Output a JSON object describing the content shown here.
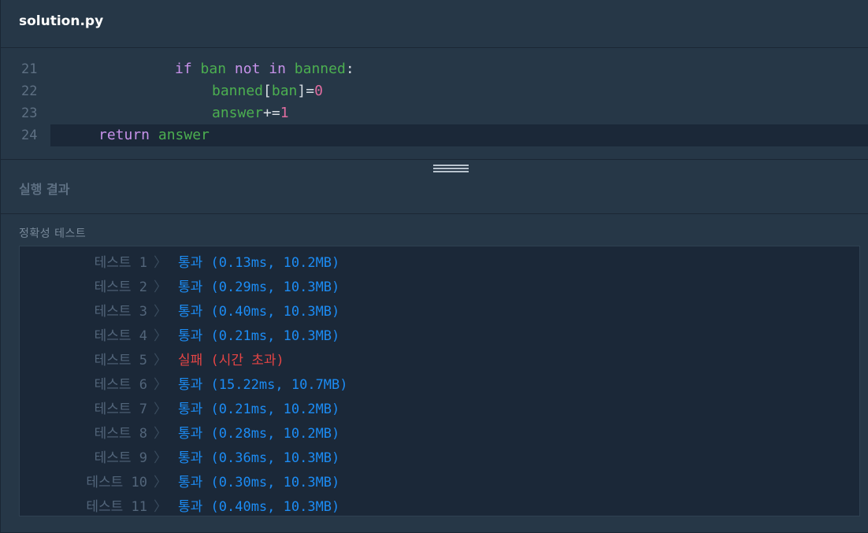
{
  "file": {
    "name": "solution.py"
  },
  "editor": {
    "lines": [
      {
        "num": "21",
        "tokens": [
          {
            "t": "if",
            "c": "kw"
          },
          {
            "t": " "
          },
          {
            "t": "ban",
            "c": "id"
          },
          {
            "t": " "
          },
          {
            "t": "not",
            "c": "kw"
          },
          {
            "t": " "
          },
          {
            "t": "in",
            "c": "kw"
          },
          {
            "t": " "
          },
          {
            "t": "banned",
            "c": "id"
          },
          {
            "t": ":",
            "c": "op"
          }
        ]
      },
      {
        "num": "22",
        "tokens": [
          {
            "t": "banned",
            "c": "id"
          },
          {
            "t": "[",
            "c": "op"
          },
          {
            "t": "ban",
            "c": "id"
          },
          {
            "t": "]=",
            "c": "op"
          },
          {
            "t": "0",
            "c": "num"
          }
        ]
      },
      {
        "num": "23",
        "tokens": [
          {
            "t": "answer",
            "c": "id"
          },
          {
            "t": "+=",
            "c": "op"
          },
          {
            "t": "1",
            "c": "num"
          }
        ]
      },
      {
        "num": "24",
        "tokens": [
          {
            "t": "return",
            "c": "kw"
          },
          {
            "t": " "
          },
          {
            "t": "answer",
            "c": "id"
          }
        ]
      }
    ]
  },
  "results_panel": {
    "title": "실행 결과",
    "section": "정확성  테스트",
    "rows": [
      {
        "label": "테스트 1",
        "result": "통과 (0.13ms, 10.2MB)",
        "status": "pass"
      },
      {
        "label": "테스트 2",
        "result": "통과 (0.29ms, 10.3MB)",
        "status": "pass"
      },
      {
        "label": "테스트 3",
        "result": "통과 (0.40ms, 10.3MB)",
        "status": "pass"
      },
      {
        "label": "테스트 4",
        "result": "통과 (0.21ms, 10.3MB)",
        "status": "pass"
      },
      {
        "label": "테스트 5",
        "result": "실패 (시간 초과)",
        "status": "fail"
      },
      {
        "label": "테스트 6",
        "result": "통과 (15.22ms, 10.7MB)",
        "status": "pass"
      },
      {
        "label": "테스트 7",
        "result": "통과 (0.21ms, 10.2MB)",
        "status": "pass"
      },
      {
        "label": "테스트 8",
        "result": "통과 (0.28ms, 10.2MB)",
        "status": "pass"
      },
      {
        "label": "테스트 9",
        "result": "통과 (0.36ms, 10.3MB)",
        "status": "pass"
      },
      {
        "label": "테스트 10",
        "result": "통과 (0.30ms, 10.3MB)",
        "status": "pass"
      },
      {
        "label": "테스트 11",
        "result": "통과 (0.40ms, 10.3MB)",
        "status": "pass"
      }
    ]
  },
  "colors": {
    "background": "#263747",
    "results_bg": "#1b2838",
    "pass": "#1c8cf4",
    "fail": "#e54545"
  }
}
